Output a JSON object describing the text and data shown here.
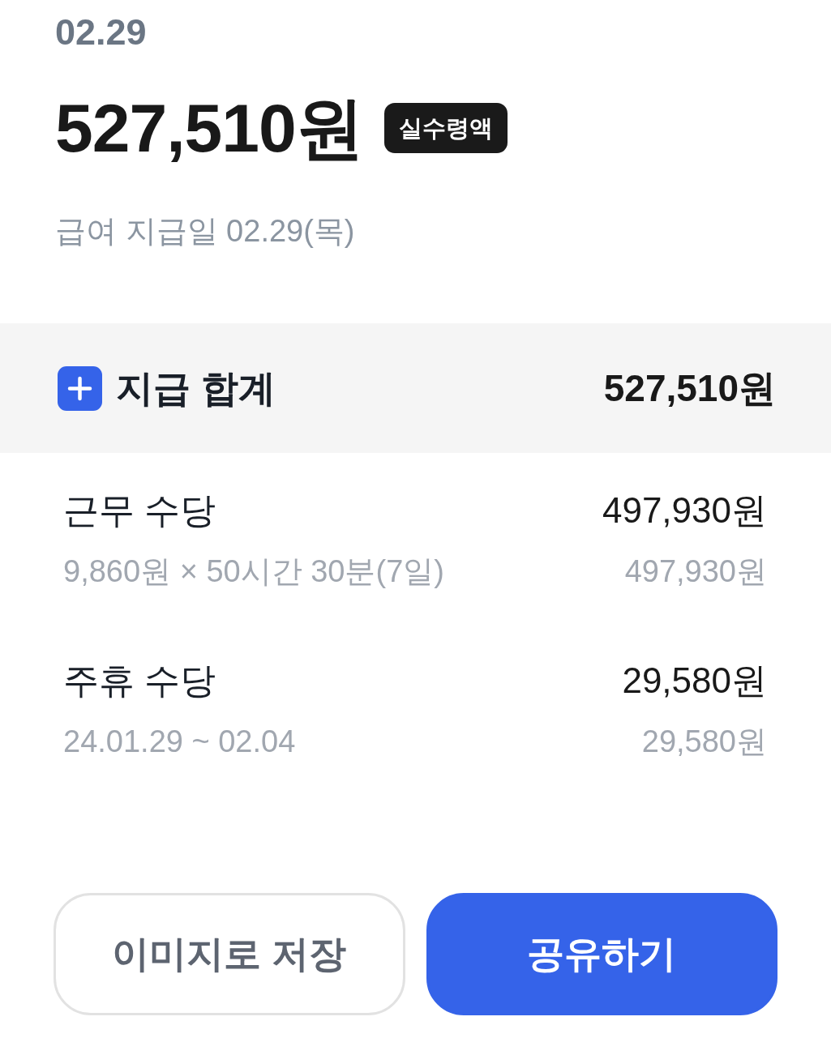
{
  "header": {
    "date": "02.29",
    "amount": "527,510원",
    "badge": "실수령액",
    "pay_date": "급여 지급일 02.29(목)"
  },
  "total": {
    "label": "지급 합계",
    "amount": "527,510원"
  },
  "items": [
    {
      "title": "근무 수당",
      "amount": "497,930원",
      "detail": "9,860원 × 50시간 30분(7일)",
      "detail_amount": "497,930원"
    },
    {
      "title": "주휴 수당",
      "amount": "29,580원",
      "detail": "24.01.29 ~ 02.04",
      "detail_amount": "29,580원"
    }
  ],
  "buttons": [
    {
      "label": "이미지로 저장",
      "kind": "secondary"
    },
    {
      "label": "공유하기",
      "kind": "primary"
    }
  ]
}
